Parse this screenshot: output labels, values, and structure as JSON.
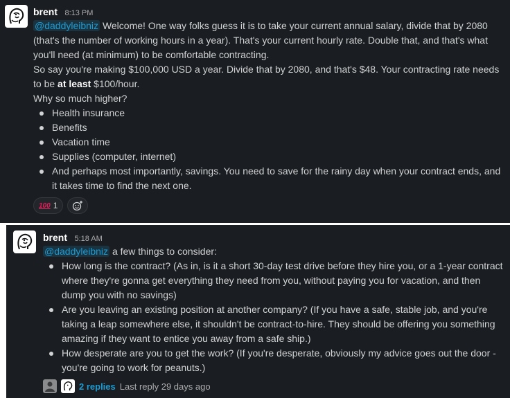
{
  "messages": [
    {
      "author": "brent",
      "time": "8:13 PM",
      "mention": "@daddyleibniz",
      "para1_text": "Welcome! One way folks guess it is to take your current annual salary, divide that by 2080 (that's the number of working hours in a year). That's your current hourly rate. Double that, and that's what you'll need (at minimum) to be comfortable contracting.",
      "para2_before": "So say you're making $100,000 USD a year. Divide that by 2080, and that's $48. Your contracting rate needs to be",
      "para2_bold": "at least",
      "para2_after": "$100/hour.",
      "para3": "Why so much higher?",
      "bullets": [
        "Health insurance",
        "Benefits",
        "Vacation time",
        "Supplies (computer, internet)",
        "And perhaps most importantly, savings. You need to save for the rainy day when your contract ends, and it takes time to find the next one."
      ],
      "reactions": [
        {
          "emoji": "100",
          "count": "1"
        }
      ],
      "add_reaction_icon": "add-emoji-icon"
    },
    {
      "author": "brent",
      "time": "5:18 AM",
      "mention": "@daddyleibniz",
      "intro": "a few things to consider:",
      "bullets": [
        "How long is the contract? (As in, is it a short 30-day test drive before they hire you, or a 1-year contract where they're gonna get everything they need from you, without paying you for vacation, and then dump you with no savings)",
        "Are you leaving an existing position at another company? (If you have a safe, stable job, and you're taking a leap somewhere else, it shouldn't be contract-to-hire. They should be offering you something amazing if they want to entice you away from a safe ship.)",
        "How desperate are you to get the work? (If you're desperate, obviously my advice goes out the door - you're going to work for peanuts.)"
      ],
      "thread": {
        "reply_count": "2 replies",
        "last_reply": "Last reply 29 days ago"
      }
    }
  ],
  "colors": {
    "background": "#1a1d21",
    "mention": "#1d9bd1",
    "text": "#d1d2d3"
  }
}
